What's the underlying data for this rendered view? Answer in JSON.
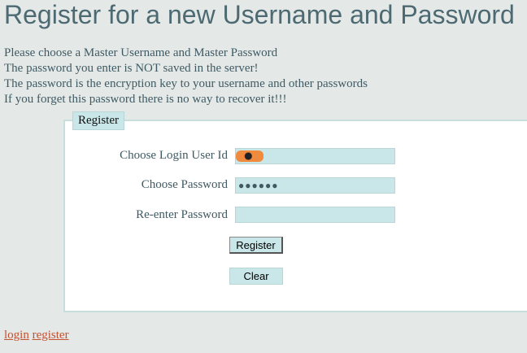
{
  "title": "Register for a new Username and Password",
  "intro": [
    "Please choose a Master Username and Master Password",
    "The password you enter is NOT saved in the server!",
    "The password is the encryption key to your username and other passwords",
    "If you forget this password there is no way to recover it!!!"
  ],
  "form": {
    "legend": "Register",
    "user_label": "Choose Login User Id",
    "pass_label": "Choose Password",
    "pass_value": "●●●●●●",
    "repass_label": "Re-enter Password",
    "register_button": "Register",
    "clear_button": "Clear"
  },
  "links": {
    "login": "login",
    "register": "register"
  }
}
